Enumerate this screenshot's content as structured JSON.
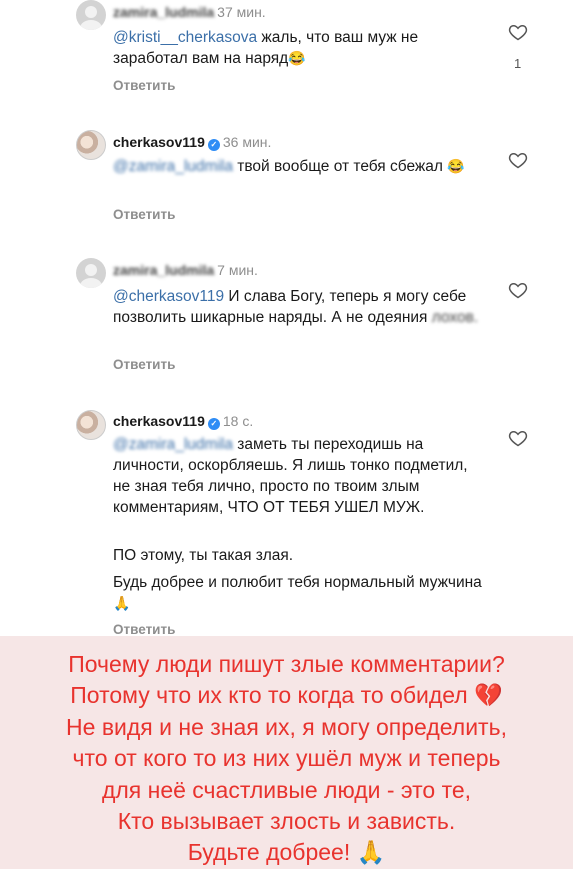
{
  "comments": [
    {
      "username": "zamira_ludmila",
      "time": "37 мин.",
      "mention": "@kristi__cherkasova",
      "text": " жаль, что ваш муж не заработал вам на наряд",
      "emoji": "😂",
      "reply": "Ответить",
      "likes": "1"
    },
    {
      "username": "cherkasov119",
      "time": "36 мин.",
      "mention": "@zamira_ludmila",
      "text": " твой вообще от тебя сбежал ",
      "emoji": "😂",
      "reply": "Ответить"
    },
    {
      "username": "zamira_ludmila",
      "time": "7 мин.",
      "mention": "@cherkasov119",
      "text": " И слава Богу, теперь я могу себе позволить шикарные наряды. А не одеяния",
      "text_tail": " лохов.",
      "reply": "Ответить"
    },
    {
      "username": "cherkasov119",
      "time": "18 с.",
      "mention": "@zamira_ludmila",
      "text": " заметь ты переходишь на личности, оскорбляешь. Я лишь тонко подметил, не зная тебя лично, просто по твоим злым комментариям, ЧТО ОТ ТЕБЯ УШЕЛ МУЖ.",
      "para2": "ПО этому, ты такая злая.",
      "para3": "Будь добрее и полюбит тебя нормальный мужчина ",
      "emoji": "🙏",
      "reply": "Ответить"
    }
  ],
  "banner": {
    "line1": "Почему люди пишут злые комментарии?",
    "line2": "Потому что их кто то когда то обидел",
    "line2_emoji": "💔",
    "line3": "Не видя и не зная их, я могу определить,",
    "line4": "что от кого то из них ушёл муж и теперь",
    "line5": "для неё счастливые люди - это те,",
    "line6": "Кто вызывает злость и зависть.",
    "line7": "Будьте добрее!",
    "line7_emoji": "🙏"
  },
  "colors": {
    "mention": "#3b6fa8",
    "banner_text": "#e8332e",
    "banner_bg": "#f6e6e6",
    "verified": "#2f8df5"
  },
  "icons": [
    "heart-outline-icon",
    "verified-badge-icon",
    "broken-heart-emoji",
    "folded-hands-emoji"
  ]
}
